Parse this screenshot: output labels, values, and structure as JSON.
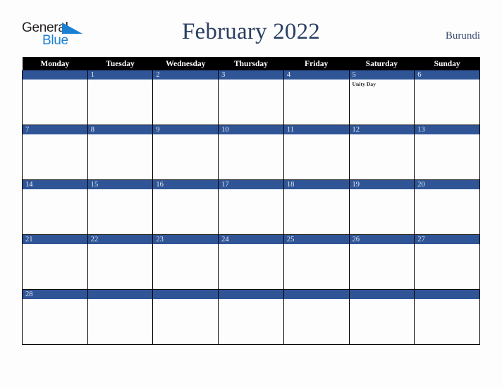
{
  "brand": {
    "word_one": "General",
    "word_two": "Blue",
    "triangle_color": "#1b7fd4",
    "word_one_color": "#231f20",
    "word_two_color": "#1b7fd4"
  },
  "header": {
    "title": "February 2022",
    "locale": "Burundi",
    "title_color": "#2b3f63",
    "locale_color": "#3c4f73"
  },
  "calendar": {
    "accent_color": "#2f5597",
    "header_background": "#000000",
    "header_text_color": "#ffffff",
    "weekdays": [
      "Monday",
      "Tuesday",
      "Wednesday",
      "Thursday",
      "Friday",
      "Saturday",
      "Sunday"
    ],
    "weeks": [
      [
        {
          "day": "",
          "events": []
        },
        {
          "day": "1",
          "events": []
        },
        {
          "day": "2",
          "events": []
        },
        {
          "day": "3",
          "events": []
        },
        {
          "day": "4",
          "events": []
        },
        {
          "day": "5",
          "events": [
            "Unity Day"
          ]
        },
        {
          "day": "6",
          "events": []
        }
      ],
      [
        {
          "day": "7",
          "events": []
        },
        {
          "day": "8",
          "events": []
        },
        {
          "day": "9",
          "events": []
        },
        {
          "day": "10",
          "events": []
        },
        {
          "day": "11",
          "events": []
        },
        {
          "day": "12",
          "events": []
        },
        {
          "day": "13",
          "events": []
        }
      ],
      [
        {
          "day": "14",
          "events": []
        },
        {
          "day": "15",
          "events": []
        },
        {
          "day": "16",
          "events": []
        },
        {
          "day": "17",
          "events": []
        },
        {
          "day": "18",
          "events": []
        },
        {
          "day": "19",
          "events": []
        },
        {
          "day": "20",
          "events": []
        }
      ],
      [
        {
          "day": "21",
          "events": []
        },
        {
          "day": "22",
          "events": []
        },
        {
          "day": "23",
          "events": []
        },
        {
          "day": "24",
          "events": []
        },
        {
          "day": "25",
          "events": []
        },
        {
          "day": "26",
          "events": []
        },
        {
          "day": "27",
          "events": []
        }
      ],
      [
        {
          "day": "28",
          "events": []
        },
        {
          "day": "",
          "events": []
        },
        {
          "day": "",
          "events": []
        },
        {
          "day": "",
          "events": []
        },
        {
          "day": "",
          "events": []
        },
        {
          "day": "",
          "events": []
        },
        {
          "day": "",
          "events": []
        }
      ]
    ]
  }
}
